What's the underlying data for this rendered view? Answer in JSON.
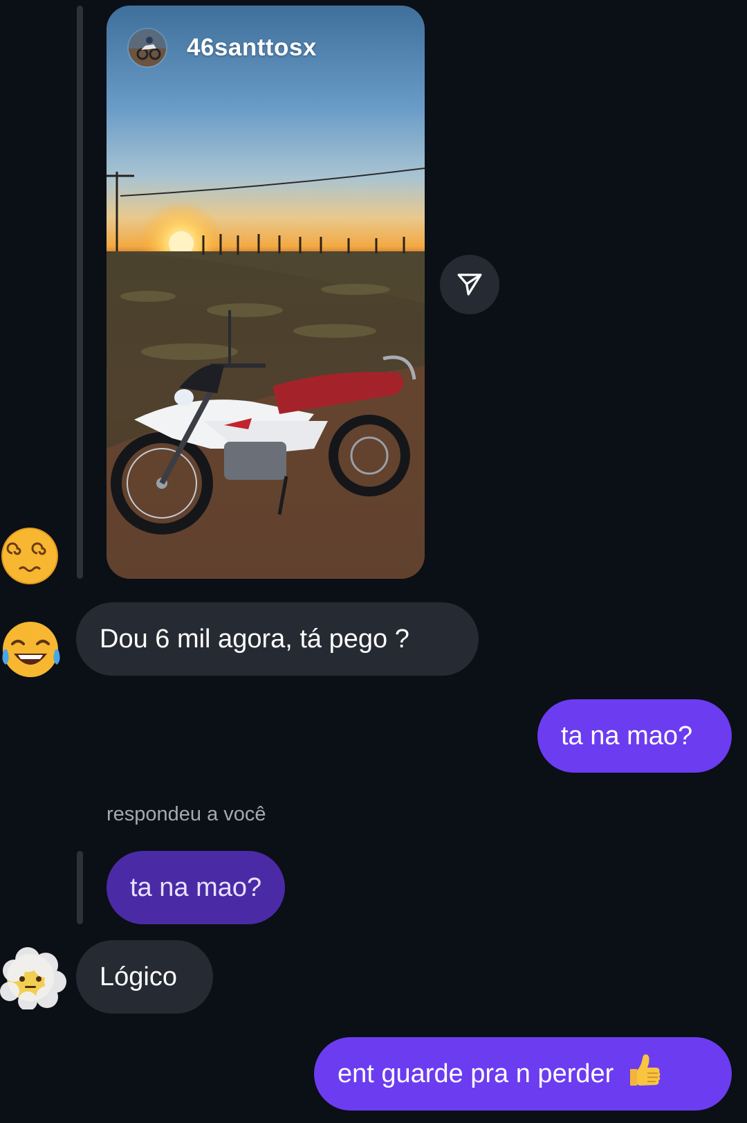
{
  "story": {
    "username": "46santtosx",
    "image_description_icon": "motorcycle-sunset-photo"
  },
  "share_button": {
    "icon": "send-icon"
  },
  "messages": [
    {
      "reaction_icon": "dizzy-face-emoji"
    },
    {
      "text": "Dou 6 mil agora, tá pego ?",
      "sender": "them",
      "avatar_icon": "tears-of-joy-emoji"
    },
    {
      "text": "ta na mao?",
      "sender": "me"
    },
    {
      "reply_label": "respondeu a você",
      "quoted_text": "ta na mao?"
    },
    {
      "text": "Lógico",
      "sender": "them",
      "avatar_icon": "face-in-clouds-emoji"
    },
    {
      "text": "ent guarde pra n perder",
      "sender": "me",
      "emoji_icon": "thumbs-up-emoji"
    }
  ],
  "colors": {
    "background": "#0b0f16",
    "incoming_bubble": "#262a33",
    "outgoing_bubble": "#6c3cf0",
    "quoted_bubble": "#4b2aa6"
  }
}
